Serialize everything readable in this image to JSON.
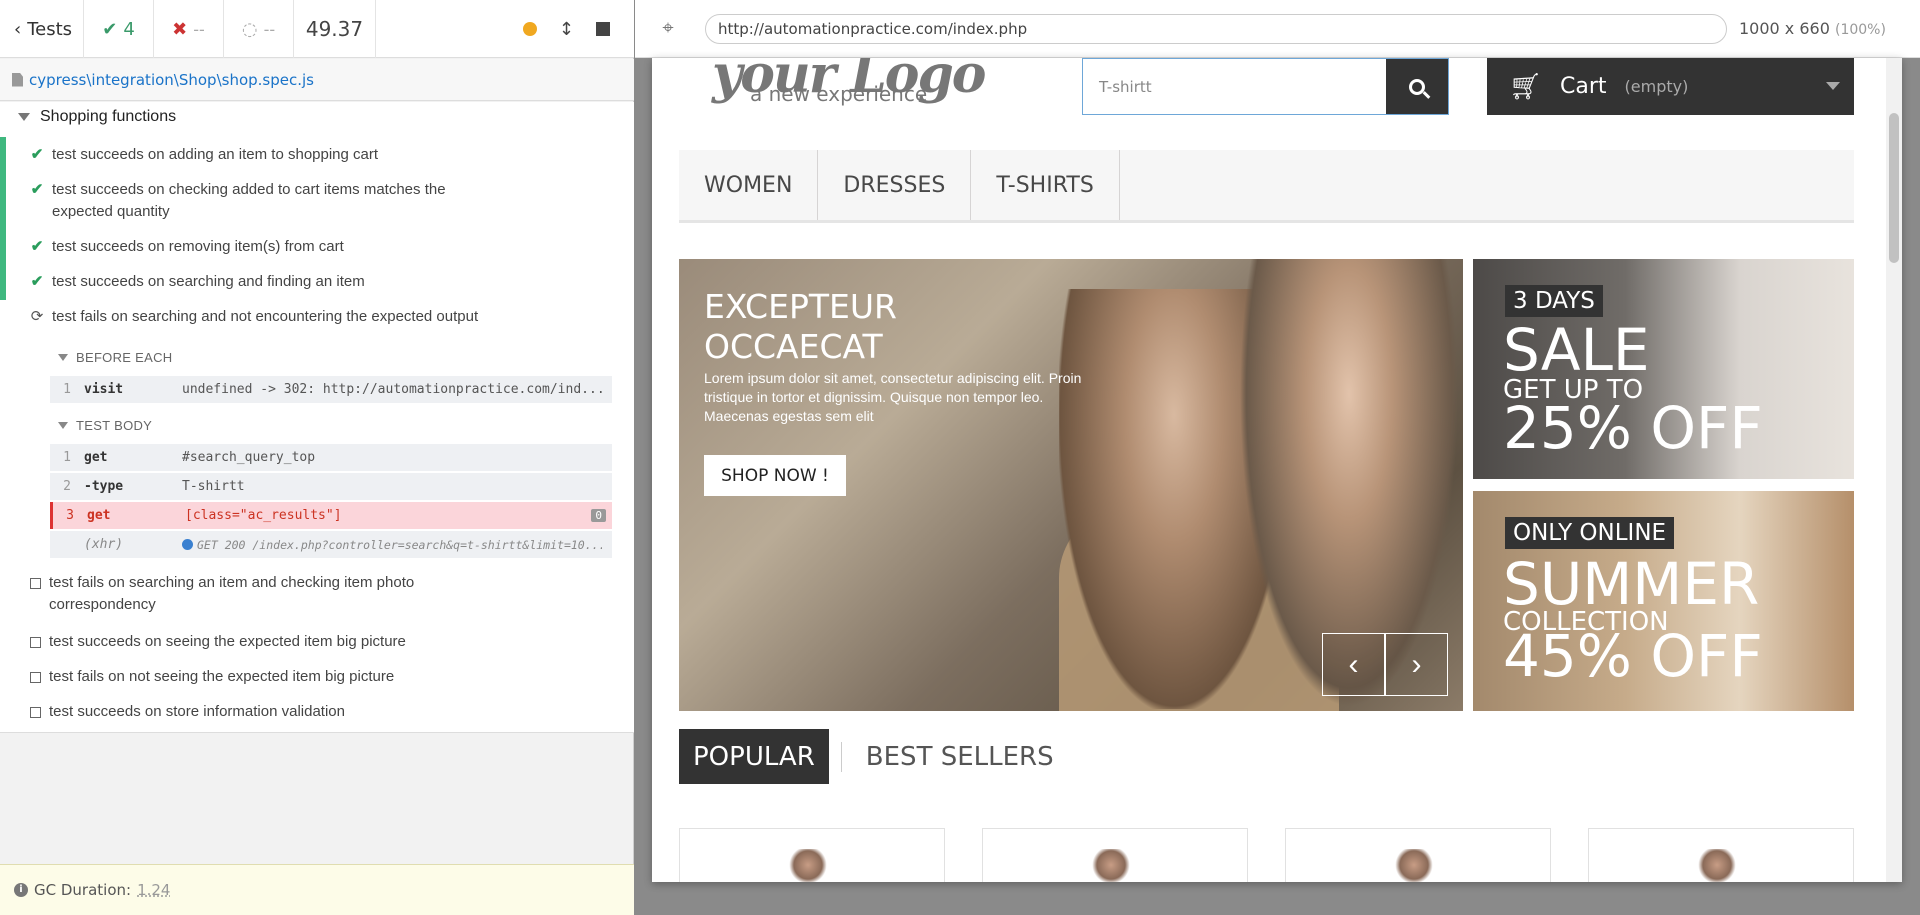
{
  "reporter": {
    "back_label": "Tests",
    "passed": "4",
    "failed": "--",
    "pending": "--",
    "duration": "49.37",
    "spec_path": "cypress\\integration\\Shop\\shop.spec.js",
    "suite_title": "Shopping functions",
    "tests": [
      {
        "state": "passed",
        "title_line1": "test succeeds on adding an item to shopping cart",
        "title_line2": ""
      },
      {
        "state": "passed",
        "title_line1": "test succeeds on checking added to cart items matches the",
        "title_line2": "expected quantity"
      },
      {
        "state": "passed",
        "title_line1": "test succeeds on removing item(s) from cart",
        "title_line2": ""
      },
      {
        "state": "passed",
        "title_line1": "test succeeds on searching and finding an item",
        "title_line2": ""
      },
      {
        "state": "running",
        "title_line1": "test fails on searching and not encountering the expected output",
        "title_line2": ""
      },
      {
        "state": "pending",
        "title_line1": "test fails on searching an item and checking item photo",
        "title_line2": "correspondency"
      },
      {
        "state": "pending",
        "title_line1": "test succeeds on seeing the expected item big picture",
        "title_line2": ""
      },
      {
        "state": "pending",
        "title_line1": "test fails on not seeing the expected item big picture",
        "title_line2": ""
      },
      {
        "state": "pending",
        "title_line1": "test succeeds on store information validation",
        "title_line2": ""
      }
    ],
    "before_each_label": "BEFORE EACH",
    "test_body_label": "TEST BODY",
    "before_each_commands": [
      {
        "num": "1",
        "name": "visit",
        "message": "undefined -> 302: http://automationpractice.com/ind..."
      }
    ],
    "test_body_commands": [
      {
        "num": "1",
        "name": "get",
        "message": "#search_query_top"
      },
      {
        "num": "2",
        "name": "-type",
        "message": "T-shirtt"
      },
      {
        "num": "3",
        "name": "get",
        "message": "[class=\"ac_results\"]",
        "badge": "0",
        "state": "failed"
      },
      {
        "num": "",
        "name": "(xhr)",
        "message": "GET 200 /index.php?controller=search&q=t-shirtt&limit=10..."
      }
    ],
    "gc_label": "GC Duration:",
    "gc_value": "1.24"
  },
  "aut": {
    "url": "http://automationpractice.com/index.php",
    "viewport_size": "1000 x 660",
    "viewport_scale": "(100%)"
  },
  "site": {
    "logo_text": "your Logo",
    "logo_tagline": "a new experience",
    "search_value": "T-shirtt",
    "cart_label": "Cart",
    "cart_status": "(empty)",
    "menu": [
      "WOMEN",
      "DRESSES",
      "T-SHIRTS"
    ],
    "slider": {
      "title_line1": "EXCEPTEUR",
      "title_line2": "OCCAECAT",
      "text": "Lorem ipsum dolor sit amet, consectetur adipiscing elit. Proin tristique in tortor et dignissim. Quisque non tempor leo. Maecenas egestas sem elit",
      "button": "SHOP NOW !"
    },
    "banner1": {
      "tag": "3 DAYS",
      "big": "SALE",
      "mid": "GET UP TO",
      "pct": "25% OFF"
    },
    "banner2": {
      "tag": "ONLY ONLINE",
      "big": "SUMMER",
      "mid": "COLLECTION",
      "pct": "45% OFF"
    },
    "tabs": [
      "POPULAR",
      "BEST SELLERS"
    ]
  },
  "colors": {
    "pass": "#3fb87f",
    "fail": "#d33333",
    "link": "#1a73c8",
    "dark": "#333333"
  },
  "icons": {
    "back": "chevron-left-icon",
    "passed": "check-icon",
    "failed": "x-icon",
    "pending": "circle-notch-icon",
    "running": "refresh-icon",
    "cart": "shopping-cart-icon",
    "search": "search-icon"
  }
}
